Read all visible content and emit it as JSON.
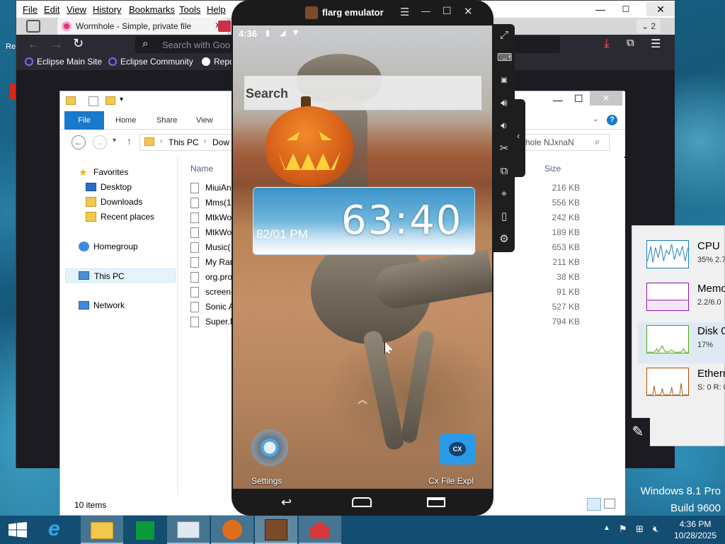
{
  "colors": {
    "explorer_accent": "#1979ca",
    "browser_dark": "#2b2a33",
    "taskbar": "#134d72",
    "firefox_download": "#ff4f5e"
  },
  "browser": {
    "menu": [
      "File",
      "Edit",
      "View",
      "History",
      "Bookmarks",
      "Tools",
      "Help"
    ],
    "tab_title": "Wormhole - Simple, private file",
    "tab_count": "2",
    "url_placeholder": "Search with Goo",
    "bookmarks": [
      "Eclipse Main Site",
      "Eclipse Community",
      "Repo"
    ]
  },
  "explorer": {
    "ribbon_tabs": [
      "File",
      "Home",
      "Share",
      "View"
    ],
    "breadcrumb": [
      "This PC",
      "Dow"
    ],
    "search_placeholder": "hole NJxnaN",
    "columns": {
      "name": "Name",
      "size": "Size"
    },
    "nav": {
      "favorites": "Favorites",
      "desktop": "Desktop",
      "downloads": "Downloads",
      "recent": "Recent places",
      "homegroup": "Homegroup",
      "thispc": "This PC",
      "network": "Network"
    },
    "files": [
      {
        "name": "MiuiAn",
        "size": "216 KB"
      },
      {
        "name": "Mms(1",
        "size": "556 KB"
      },
      {
        "name": "MtkWo",
        "size": "242 KB"
      },
      {
        "name": "MtkWo",
        "size": "189 KB"
      },
      {
        "name": "Music(",
        "size": "653 KB"
      },
      {
        "name": "My Ran",
        "size": "211 KB"
      },
      {
        "name": "org.pro",
        "size": "38 KB"
      },
      {
        "name": "screen-",
        "size": "91 KB"
      },
      {
        "name": "Sonic A",
        "size": "527 KB"
      },
      {
        "name": "Super.M",
        "size": "794 KB"
      }
    ],
    "status": "10 items"
  },
  "emulator": {
    "title": "flarg emulator",
    "status_time": "4:36",
    "search_label": "Search",
    "clock_big": "63:40",
    "clock_small": "82/01 PM",
    "apps": [
      {
        "label": "Settings",
        "icon": "settings-icon"
      },
      {
        "label": "Cx File Expl",
        "icon": "cx-file-explorer-icon",
        "badge": "CX"
      }
    ]
  },
  "taskmgr": {
    "rows": [
      {
        "title": "CPU",
        "sub": "35% 2.7",
        "color": "#117dbb"
      },
      {
        "title": "Memo",
        "sub": "2.2/6.0",
        "color": "#8b12ae"
      },
      {
        "title": "Disk 0",
        "sub": "17%",
        "color": "#4da60c"
      },
      {
        "title": "Ethern",
        "sub": "S: 0 R: 0",
        "color": "#a74f01"
      }
    ]
  },
  "desktop": {
    "edition": "Windows 8.1 Pro",
    "build": "Build 9600"
  },
  "taskbar": {
    "time": "4:36 PM",
    "date": "10/28/2025"
  }
}
